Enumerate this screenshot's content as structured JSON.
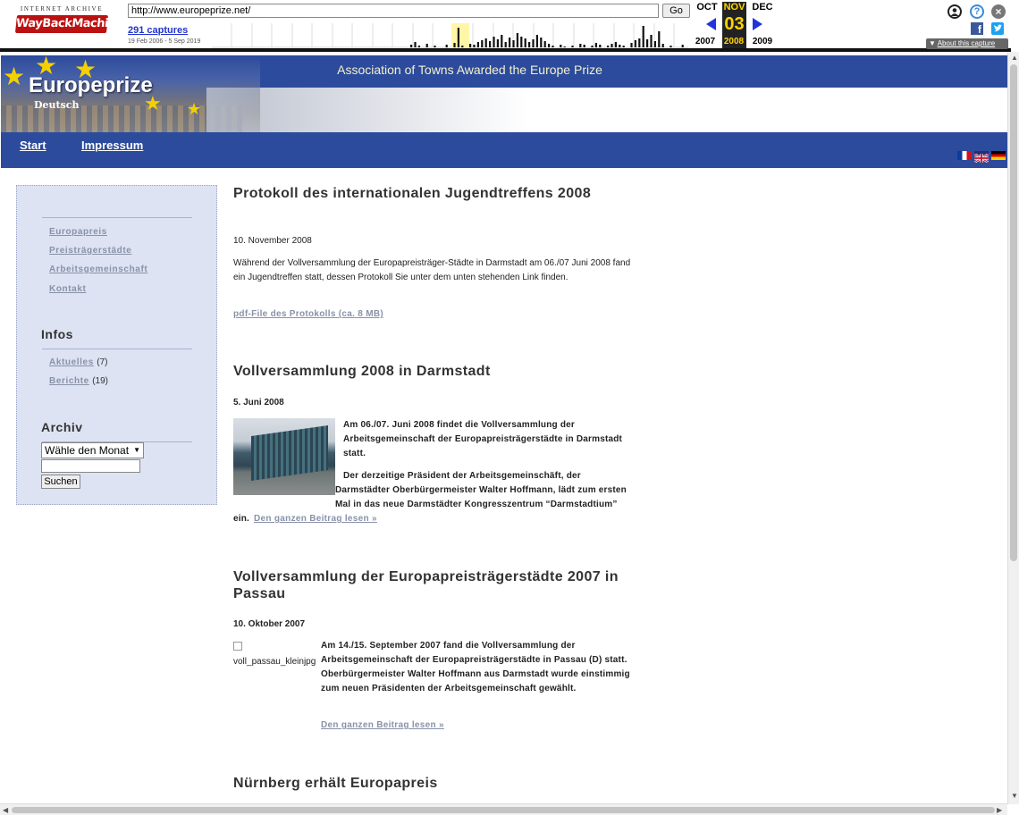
{
  "wayback": {
    "logo_top": "INTERNET ARCHIVE",
    "logo_main": "WayBackMachine",
    "url": "http://www.europeprize.net/",
    "go_label": "Go",
    "captures": "291 captures",
    "range": "19 Feb 2006 - 5 Sep 2019",
    "prev_month": "OCT",
    "cur_month": "NOV",
    "next_month": "DEC",
    "day": "03",
    "prev_year": "2007",
    "cur_year": "2008",
    "next_year": "2009",
    "about": "About this capture",
    "accent": "#ffd400"
  },
  "header": {
    "tagline": "Association of Towns Awarded the Europe Prize",
    "site_title": "Europeprize",
    "language": "Deutsch",
    "band_color": "#2c4b9c"
  },
  "nav": {
    "start": "Start",
    "impressum": "Impressum"
  },
  "sidebar": {
    "links": [
      "Europapreis",
      "Preisträgerstädte",
      "Arbeitsgemeinschaft",
      "Kontakt"
    ],
    "infos_title": "Infos",
    "aktuelles": "Aktuelles",
    "aktuelles_count": "(7)",
    "berichte": "Berichte",
    "berichte_count": "(19)",
    "archiv_title": "Archiv",
    "month_select": "Wähle den Monat",
    "search_button": "Suchen"
  },
  "posts": [
    {
      "title": "Protokoll des internationalen Jugendtreffens 2008",
      "date": "10. November 2008",
      "text": "Während der Vollversammlung der Europapreisträger-Städte in Darmstadt am 06./07 Juni 2008 fand ein Jugendtreffen statt, dessen Protokoll Sie unter dem unten stehenden Link finden.",
      "link": "pdf-File des Protokolls (ca. 8 MB)"
    },
    {
      "title": "Vollversammlung 2008 in Darmstadt",
      "date": "5. Juni 2008",
      "p1": "Am 06./07. Juni 2008 findet die Vollversammlung der Arbeitsgemeinschaft der Europapreisträgerstädte in Darmstadt statt.",
      "p2": "Der derzeitige Präsident der Arbeitsgemeinschäft, der Darmstädter Oberbürgermeister Walter Hoffmann, lädt zum ersten Mal in das neue Darmstädter Kongresszentrum “Darmstadtium” ein.",
      "more": "Den ganzen Beitrag lesen »"
    },
    {
      "title": "Vollversammlung der Europapreisträgerstädte 2007 in Passau",
      "date": "10. Oktober 2007",
      "img_alt": "voll_passau_kleinjpg",
      "text": "Am 14./15. September 2007 fand die Vollversammlung der Arbeitsgemeinschaft der Europapreisträgerstädte in Passau (D) statt. Oberbürgermeister Walter Hoffmann aus Darmstadt wurde einstimmig zum neuen Präsidenten der Arbeitsgemeinschaft gewählt.",
      "more": "Den ganzen Beitrag lesen »"
    },
    {
      "title": "Nürnberg erhält Europapreis"
    }
  ]
}
